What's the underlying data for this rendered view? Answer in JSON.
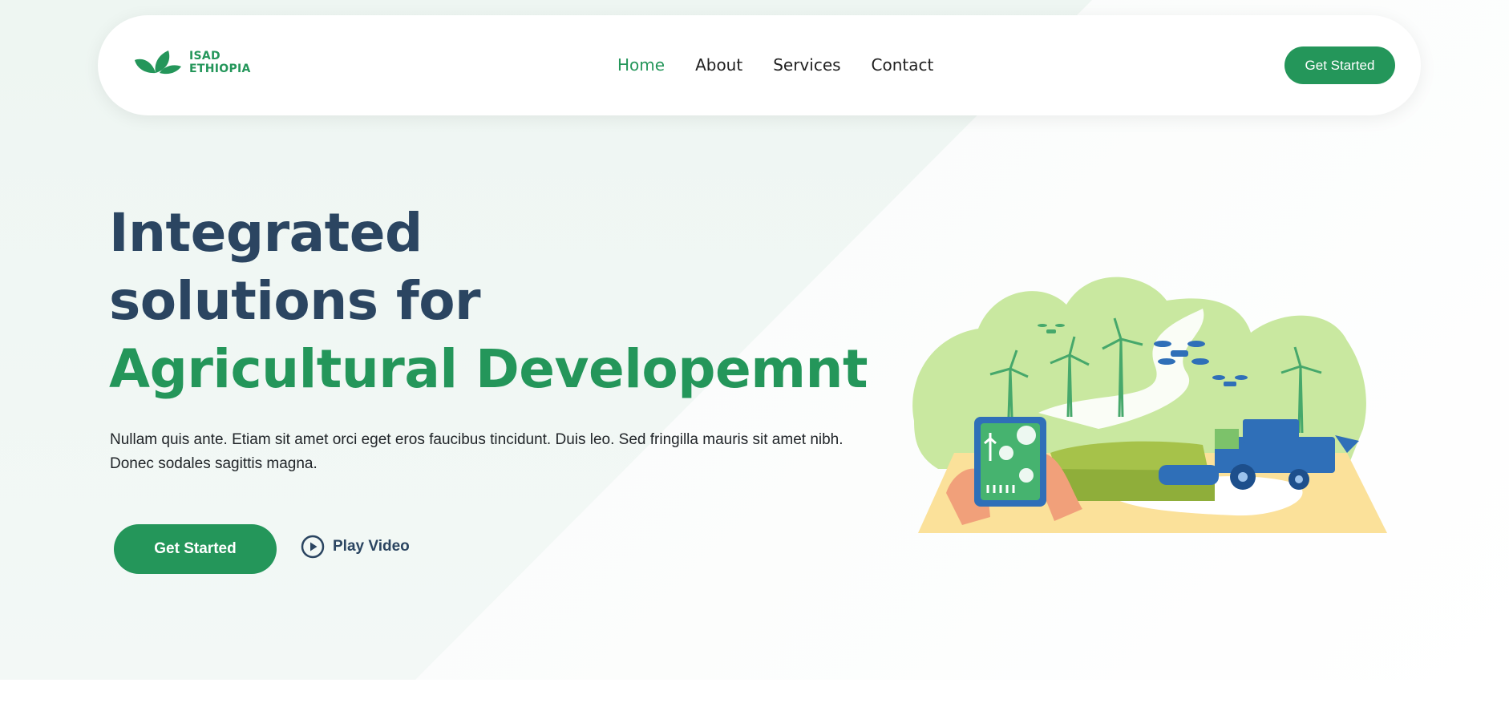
{
  "header": {
    "logo": {
      "line1": "ISAD",
      "line2": "ETHIOPIA"
    },
    "nav": [
      {
        "label": "Home",
        "active": true
      },
      {
        "label": "About",
        "active": false
      },
      {
        "label": "Services",
        "active": false
      },
      {
        "label": "Contact",
        "active": false
      }
    ],
    "cta_label": "Get Started"
  },
  "hero": {
    "title_line1": "Integrated",
    "title_line2": "solutions for",
    "title_line3": "Agricultural Developemnt",
    "description": "Nullam quis ante. Etiam sit amet orci eget eros faucibus tincidunt. Duis leo. Sed fringilla mauris sit amet nibh. Donec sodales sagittis magna.",
    "cta_label": "Get Started",
    "video_label": "Play Video",
    "illustration": "smart-farming-illustration"
  },
  "colors": {
    "accent": "#24965a",
    "heading": "#2b4561",
    "text": "#212529"
  }
}
